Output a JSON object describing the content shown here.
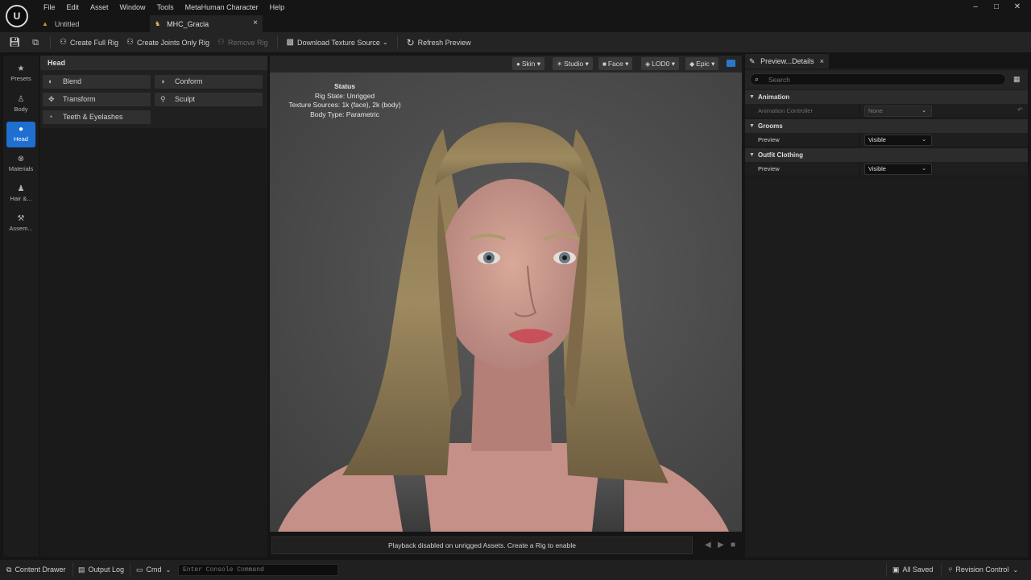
{
  "menu": {
    "logo": "U",
    "items": [
      "File",
      "Edit",
      "Asset",
      "Window",
      "Tools",
      "MetaHuman Character",
      "Help"
    ]
  },
  "window_controls": {
    "minimize": "–",
    "maximize": "□",
    "close": "✕"
  },
  "tabs": [
    {
      "label": "Untitled"
    },
    {
      "label": "MHC_Gracia",
      "close": "×"
    }
  ],
  "toolbar": {
    "create_full_rig": "Create Full Rig",
    "create_joints_only_rig": "Create Joints Only Rig",
    "remove_rig": "Remove Rig",
    "download_texture_source": "Download Texture Source",
    "refresh_preview": "Refresh Preview"
  },
  "leftbar": {
    "items": [
      {
        "label": "Presets",
        "icon": "star-icon"
      },
      {
        "label": "Body",
        "icon": "body-icon"
      },
      {
        "label": "Head",
        "icon": "head-icon",
        "active": true
      },
      {
        "label": "Materials",
        "icon": "materials-icon"
      },
      {
        "label": "Hair &...",
        "icon": "hair-icon"
      },
      {
        "label": "Assem...",
        "icon": "assembly-icon"
      }
    ]
  },
  "head_panel": {
    "title": "Head",
    "tools": [
      "Blend",
      "Conform",
      "Transform",
      "Sculpt",
      "Teeth & Eyelashes"
    ]
  },
  "viewport": {
    "chips": [
      "Skin",
      "Studio",
      "Face",
      "LOD0",
      "Epic"
    ],
    "status": {
      "title": "Status",
      "rig_state": "Rig State: Unrigged",
      "texture_sources": "Texture Sources: 1k (face), 2k (body)",
      "body_type": "Body Type: Parametric"
    },
    "playback_message": "Playback disabled on unrigged Assets. Create a Rig to enable"
  },
  "details": {
    "tab_label": "Preview...Details",
    "tab_close": "×",
    "search_placeholder": "Search",
    "categories": {
      "animation": {
        "label": "Animation",
        "prop_label": "Animation Controller",
        "prop_value": "None"
      },
      "grooms": {
        "label": "Grooms",
        "prop_label": "Preview",
        "prop_value": "Visible"
      },
      "outfit": {
        "label": "Outfit Clothing",
        "prop_label": "Preview",
        "prop_value": "Visible"
      }
    }
  },
  "statusbar": {
    "content_drawer": "Content Drawer",
    "output_log": "Output Log",
    "cmd": "Cmd",
    "console_placeholder": "Enter Console Command",
    "all_saved": "All Saved",
    "revision_control": "Revision Control"
  }
}
